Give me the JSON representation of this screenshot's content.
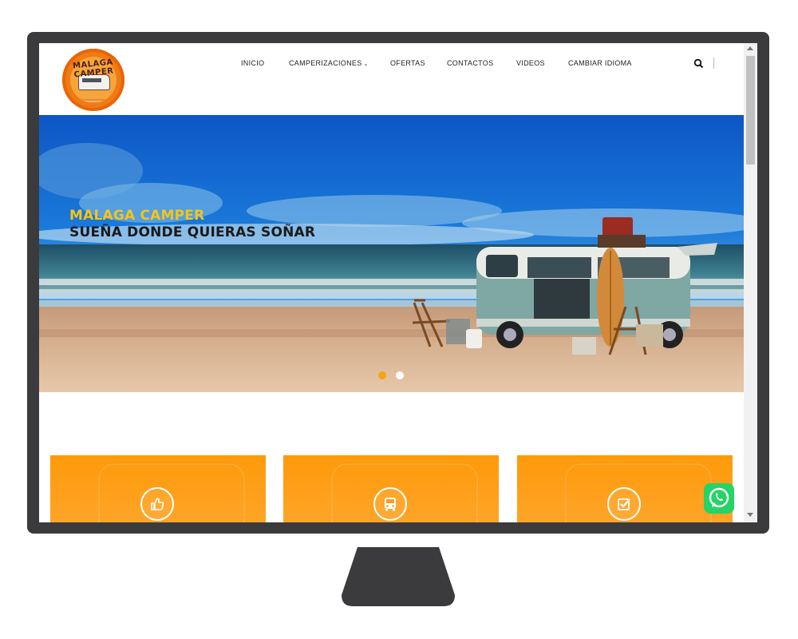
{
  "logo": {
    "text": "MALAGA CAMPER"
  },
  "nav": {
    "items": [
      {
        "label": "INICIO"
      },
      {
        "label": "CAMPERIZACIONES",
        "has_dropdown": true
      },
      {
        "label": "OFERTAS"
      },
      {
        "label": "CONTACTOS"
      },
      {
        "label": "VIDEOS"
      },
      {
        "label": "CAMBIAR IDIOMA"
      }
    ],
    "search_icon": "search-icon"
  },
  "hero": {
    "title": "MALAGA CAMPER",
    "subtitle": "SUEÑA DONDE QUIERAS SOÑAR",
    "slides_total": 2,
    "active_slide": 1
  },
  "features": [
    {
      "icon": "thumbs-up-icon"
    },
    {
      "icon": "bus-icon"
    },
    {
      "icon": "check-square-icon"
    }
  ],
  "whatsapp": {
    "icon": "whatsapp-icon"
  },
  "colors": {
    "accent": "#f5a312",
    "title_yellow": "#f5c518",
    "card_orange": "#ff9a0a",
    "whatsapp_green": "#25d366",
    "bezel": "#3b3b3d"
  }
}
